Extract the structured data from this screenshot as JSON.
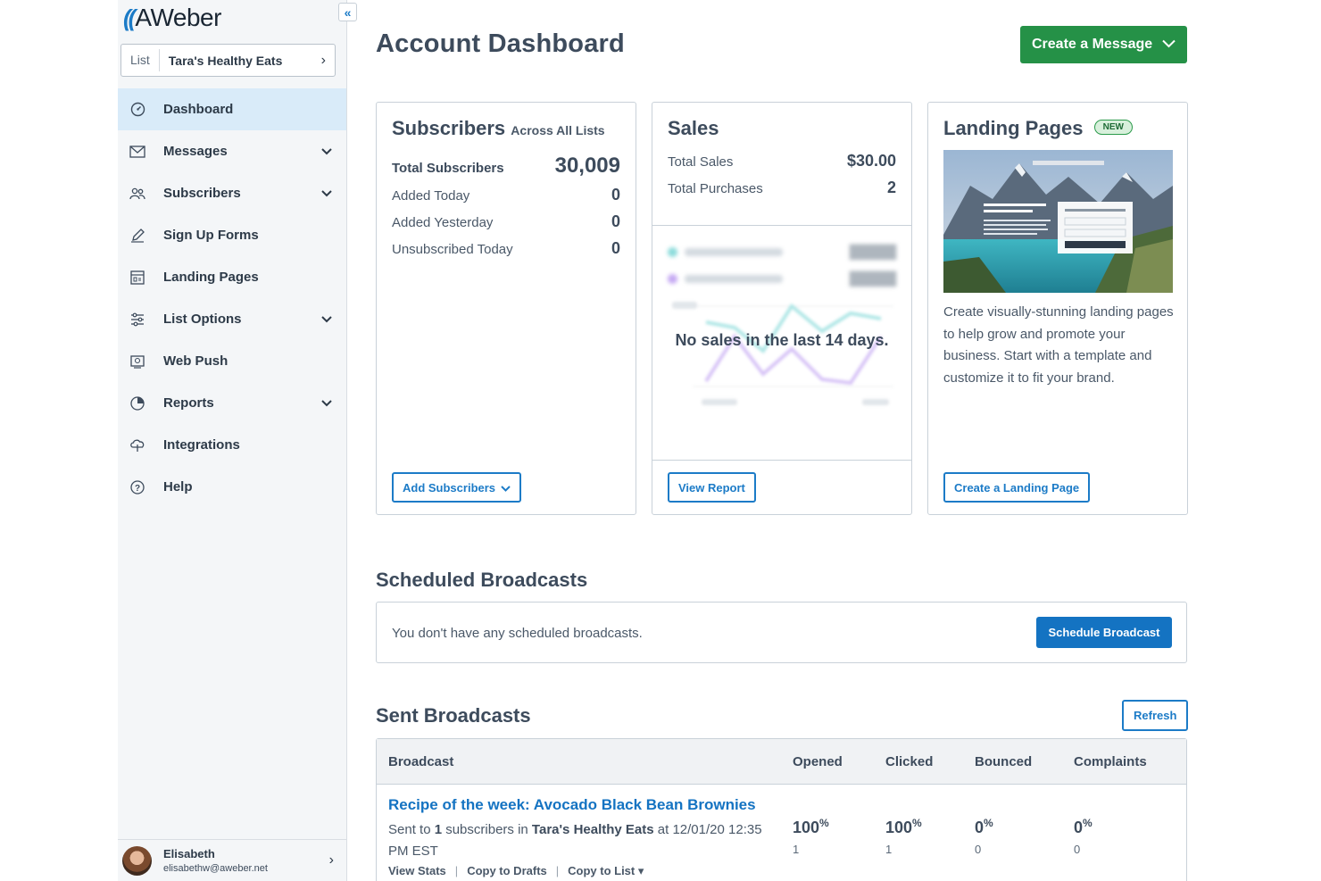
{
  "app": {
    "logo_text": "AWeber",
    "collapse_icon": "double-chevron-left"
  },
  "list_selector": {
    "label": "List",
    "value": "Tara's Healthy Eats"
  },
  "sidebar": {
    "items": [
      {
        "label": "Dashboard",
        "icon": "dashboard-gauge",
        "active": true,
        "expandable": false
      },
      {
        "label": "Messages",
        "icon": "envelope",
        "active": false,
        "expandable": true
      },
      {
        "label": "Subscribers",
        "icon": "people",
        "active": false,
        "expandable": true
      },
      {
        "label": "Sign Up Forms",
        "icon": "pencil",
        "active": false,
        "expandable": false
      },
      {
        "label": "Landing Pages",
        "icon": "layout-page",
        "active": false,
        "expandable": false
      },
      {
        "label": "List Options",
        "icon": "sliders",
        "active": false,
        "expandable": true
      },
      {
        "label": "Web Push",
        "icon": "push-screen",
        "active": false,
        "expandable": false
      },
      {
        "label": "Reports",
        "icon": "pie-chart",
        "active": false,
        "expandable": true
      },
      {
        "label": "Integrations",
        "icon": "cloud-plug",
        "active": false,
        "expandable": false
      },
      {
        "label": "Help",
        "icon": "question-circle",
        "active": false,
        "expandable": false
      }
    ]
  },
  "user": {
    "name": "Elisabeth",
    "email": "elisabethw@aweber.net"
  },
  "header": {
    "title": "Account Dashboard",
    "create_button": "Create a Message"
  },
  "subscribers_card": {
    "title": "Subscribers",
    "subtitle": "Across All Lists",
    "total_label": "Total Subscribers",
    "total_value": "30,009",
    "rows": [
      {
        "label": "Added Today",
        "value": "0"
      },
      {
        "label": "Added Yesterday",
        "value": "0"
      },
      {
        "label": "Unsubscribed Today",
        "value": "0"
      }
    ],
    "button": "Add Subscribers"
  },
  "sales_card": {
    "title": "Sales",
    "rows": [
      {
        "label": "Total Sales",
        "value": "$30.00"
      },
      {
        "label": "Total Purchases",
        "value": "2"
      }
    ],
    "empty_message": "No sales in the last 14 days.",
    "button": "View Report"
  },
  "landing_card": {
    "title": "Landing Pages",
    "badge": "NEW",
    "description": "Create visually-stunning landing pages to help grow and promote your business. Start with a template and customize it to fit your brand.",
    "button": "Create a Landing Page"
  },
  "scheduled": {
    "title": "Scheduled Broadcasts",
    "empty_text": "You don't have any scheduled broadcasts.",
    "button": "Schedule Broadcast"
  },
  "sent": {
    "title": "Sent Broadcasts",
    "refresh_button": "Refresh",
    "columns": [
      "Broadcast",
      "Opened",
      "Clicked",
      "Bounced",
      "Complaints"
    ],
    "rows": [
      {
        "title": "Recipe of the week: Avocado Black Bean Brownies",
        "meta_prefix": "Sent to ",
        "meta_count": "1",
        "meta_mid": " subscribers in ",
        "meta_list": "Tara's Healthy Eats",
        "meta_suffix": " at 12/01/20 12:35 PM EST",
        "opened_pct": "100",
        "opened_count": "1",
        "clicked_pct": "100",
        "clicked_count": "1",
        "bounced_pct": "0",
        "bounced_count": "0",
        "complaints_pct": "0",
        "complaints_count": "0",
        "links": [
          "View Stats",
          "Copy to Drafts",
          "Copy to List ▾"
        ]
      }
    ]
  },
  "colors": {
    "brand_blue": "#1473c2",
    "green": "#259147",
    "active_nav": "#d9ebf9",
    "sales_this_week": "#6fd3d2",
    "sales_last_week": "#b794f0"
  }
}
